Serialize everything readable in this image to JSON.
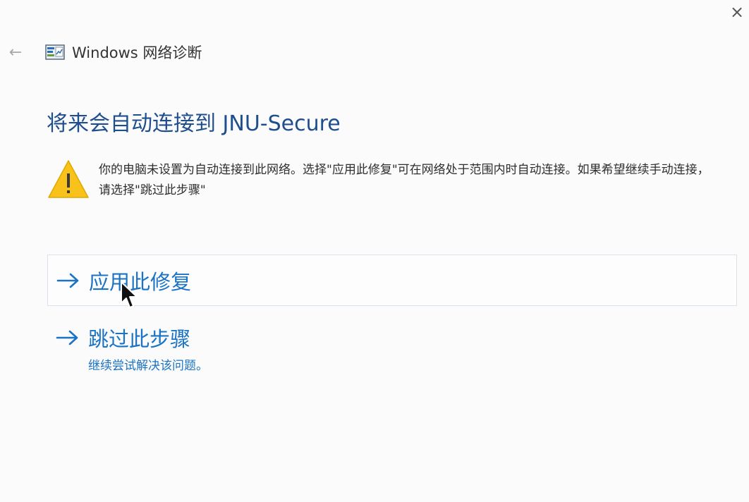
{
  "window": {
    "title": "Windows 网络诊断",
    "app_icon": "network-diagnostics-icon",
    "close_glyph": "×",
    "back_glyph": "←"
  },
  "heading": "将来会自动连接到 JNU-Secure",
  "warning": {
    "icon": "warning-icon",
    "text": "你的电脑未设置为自动连接到此网络。选择\"应用此修复\"可在网络处于范围内时自动连接。如果希望继续手动连接，请选择\"跳过此步骤\""
  },
  "options": {
    "apply": {
      "label": "应用此修复",
      "icon": "arrow-right-icon"
    },
    "skip": {
      "label": "跳过此步骤",
      "sub": "继续尝试解决该问题。",
      "icon": "arrow-right-icon"
    }
  },
  "colors": {
    "heading": "#1f4e8f",
    "link": "#1a73c4",
    "warning_yellow": "#f8c21b",
    "option_border": "#d9e2ec"
  }
}
